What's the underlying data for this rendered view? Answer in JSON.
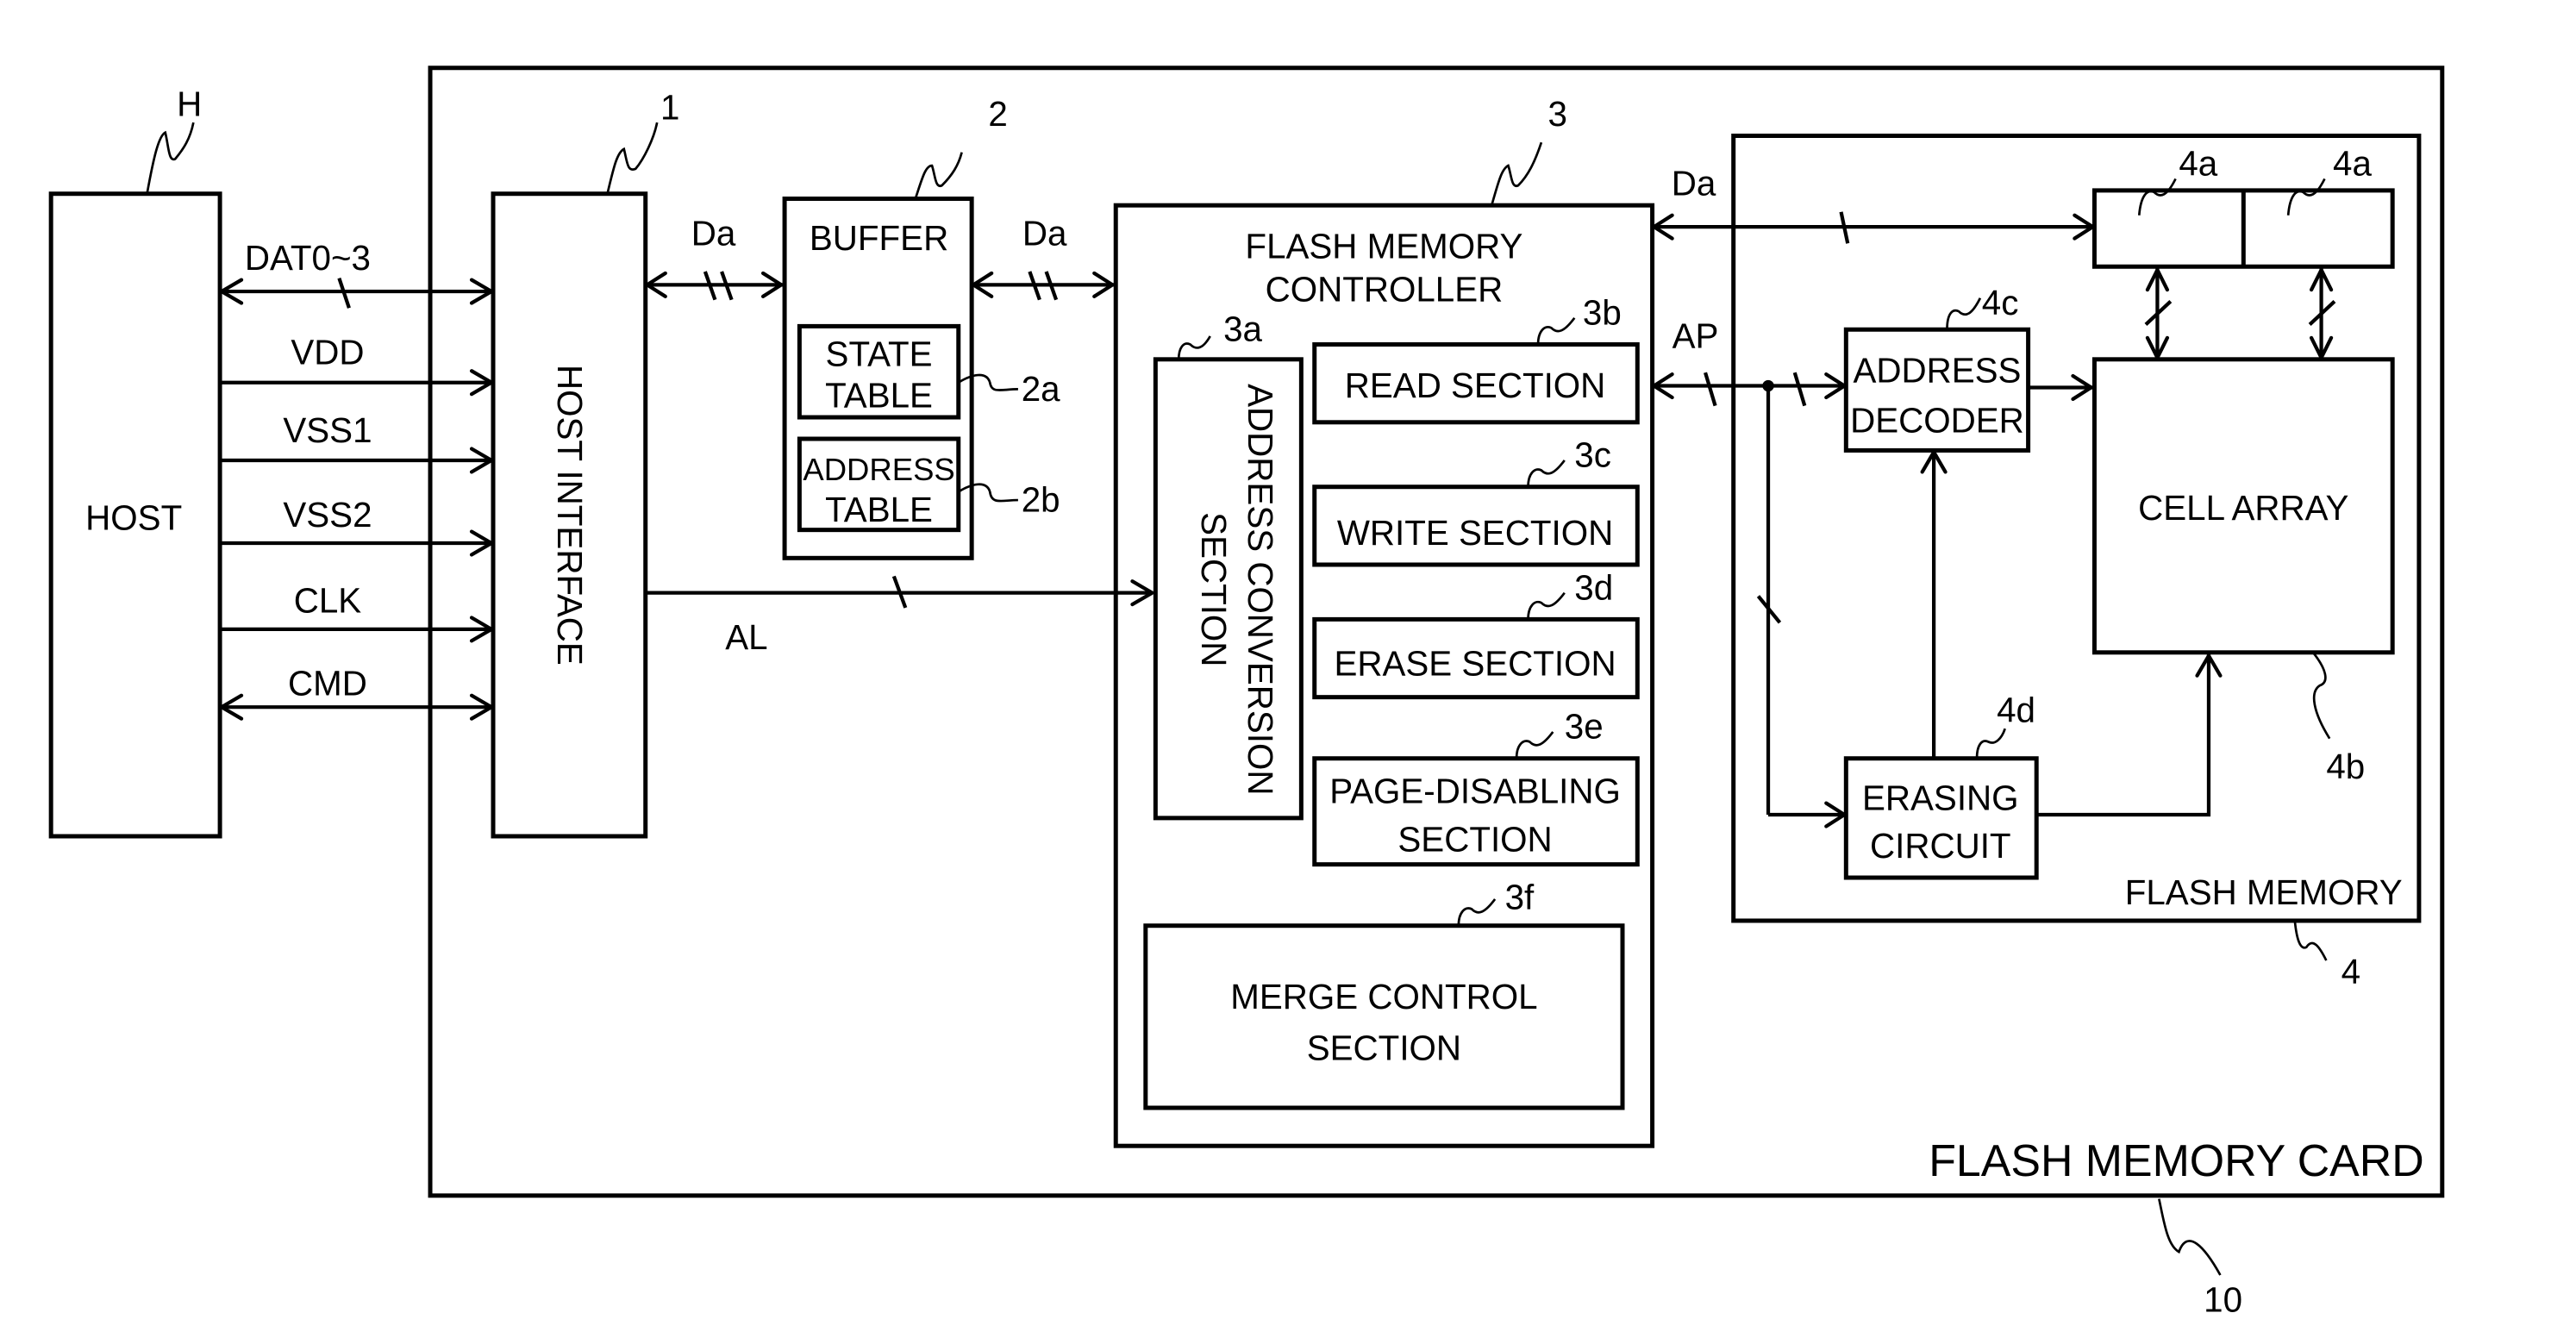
{
  "diagram": {
    "title_card": "FLASH MEMORY CARD",
    "ref_card": "10",
    "host": {
      "label": "HOST",
      "ref": "H"
    },
    "host_interface": {
      "label": "HOST INTERFACE",
      "ref": "1"
    },
    "buffer": {
      "label": "BUFFER",
      "ref": "2",
      "state_table": {
        "line1": "STATE",
        "line2": "TABLE",
        "ref": "2a"
      },
      "address_table": {
        "line1": "ADDRESS",
        "line2": "TABLE",
        "ref": "2b"
      }
    },
    "controller": {
      "line1": "FLASH MEMORY",
      "line2": "CONTROLLER",
      "ref": "3",
      "address_conversion": {
        "line1": "ADDRESS CONVERSION",
        "line2": "SECTION",
        "ref": "3a"
      },
      "read": {
        "label": "READ  SECTION",
        "ref": "3b"
      },
      "write": {
        "label": "WRITE  SECTION",
        "ref": "3c"
      },
      "erase": {
        "label": "ERASE  SECTION",
        "ref": "3d"
      },
      "page_disabling": {
        "line1": "PAGE-DISABLING",
        "line2": "SECTION",
        "ref": "3e"
      },
      "merge_control": {
        "line1": "MERGE  CONTROL",
        "line2": "SECTION",
        "ref": "3f"
      }
    },
    "flash_memory": {
      "label": "FLASH  MEMORY",
      "ref": "4",
      "page_buffer_ref_1": "4a",
      "page_buffer_ref_2": "4a",
      "cell_array": {
        "label": "CELL  ARRAY",
        "ref": "4b"
      },
      "address_decoder": {
        "line1": "ADDRESS",
        "line2": "DECODER",
        "ref": "4c"
      },
      "erasing_circuit": {
        "line1": "ERASING",
        "line2": "CIRCUIT",
        "ref": "4d"
      }
    },
    "signals": {
      "dat": "DAT0~3",
      "vdd": "VDD",
      "vss1": "VSS1",
      "vss2": "VSS2",
      "clk": "CLK",
      "cmd": "CMD",
      "da_hi_buf": "Da",
      "da_buf_ctrl": "Da",
      "da_ctrl_mem": "Da",
      "al": "AL",
      "ap": "AP"
    }
  }
}
